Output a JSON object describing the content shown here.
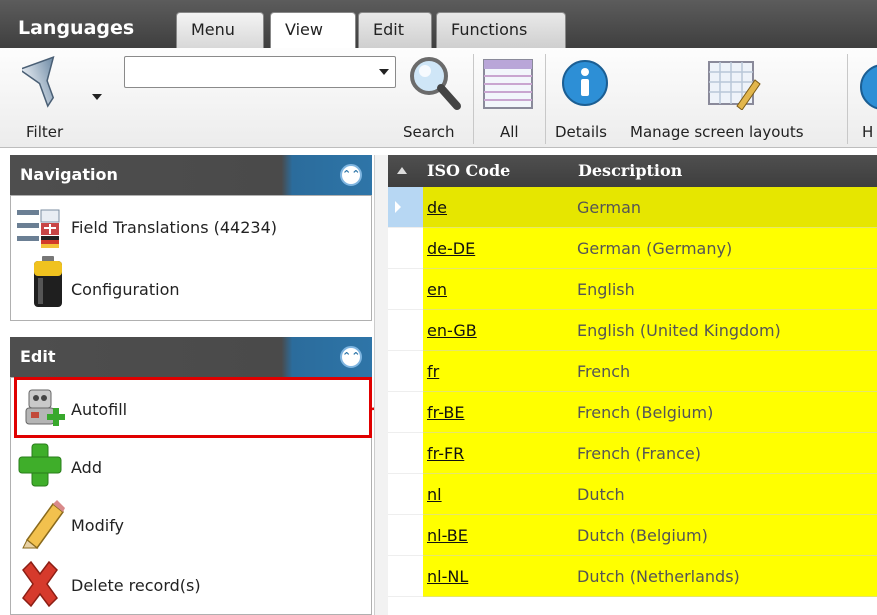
{
  "app": {
    "title": "Languages"
  },
  "tabs": [
    {
      "label": "Menu"
    },
    {
      "label": "View"
    },
    {
      "label": "Edit"
    },
    {
      "label": "Functions"
    }
  ],
  "ribbon": {
    "filter_label": "Filter",
    "filter_value": "",
    "search_label": "Search",
    "all_label": "All",
    "details_label": "Details",
    "layouts_label": "Manage screen layouts",
    "help_label_partial": "H"
  },
  "navigation": {
    "title": "Navigation",
    "items": [
      {
        "label": "Field Translations (44234)",
        "icon": "field-translations-icon"
      },
      {
        "label": "Configuration",
        "icon": "battery-icon"
      }
    ]
  },
  "edit": {
    "title": "Edit",
    "items": [
      {
        "label": "Autofill",
        "icon": "autofill-robot-icon"
      },
      {
        "label": "Add",
        "icon": "plus-icon"
      },
      {
        "label": "Modify",
        "icon": "pencil-icon"
      },
      {
        "label": "Delete record(s)",
        "icon": "delete-x-icon"
      }
    ]
  },
  "grid": {
    "columns": [
      "ISO Code",
      "Description"
    ],
    "rows": [
      {
        "code": "de",
        "desc": "German"
      },
      {
        "code": "de-DE",
        "desc": "German (Germany)"
      },
      {
        "code": "en",
        "desc": "English"
      },
      {
        "code": "en-GB",
        "desc": "English (United Kingdom)"
      },
      {
        "code": "fr",
        "desc": "French"
      },
      {
        "code": "fr-BE",
        "desc": "French (Belgium)"
      },
      {
        "code": "fr-FR",
        "desc": "French (France)"
      },
      {
        "code": "nl",
        "desc": "Dutch"
      },
      {
        "code": "nl-BE",
        "desc": "Dutch (Belgium)"
      },
      {
        "code": "nl-NL",
        "desc": "Dutch (Netherlands)"
      }
    ]
  },
  "colors": {
    "row_highlight": "#ffff00",
    "selected_row": "#e6e600",
    "panel_accent": "#2e75a8",
    "annotation": "#e00000"
  }
}
